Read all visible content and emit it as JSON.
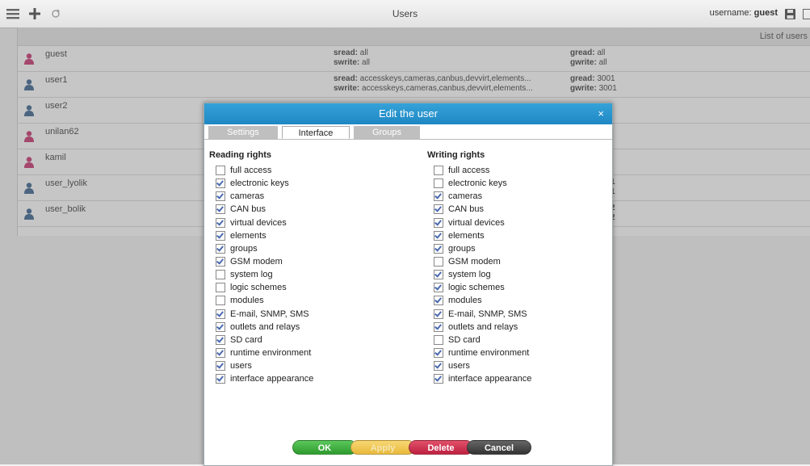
{
  "header": {
    "title": "Users",
    "username_label": "username:",
    "username_value": "guest"
  },
  "list": {
    "header_label": "List of users",
    "users": [
      {
        "name": "guest",
        "avatar_color": "#c2185b",
        "sread_label": "sread:",
        "sread": "all",
        "swrite_label": "swrite:",
        "swrite": "all",
        "gread_label": "gread:",
        "gread": "all",
        "gwrite_label": "gwrite:",
        "gwrite": "all"
      },
      {
        "name": "user1",
        "avatar_color": "#1f4f80",
        "sread_label": "sread:",
        "sread": "accesskeys,cameras,canbus,devvirt,elements...",
        "swrite_label": "swrite:",
        "swrite": "accesskeys,cameras,canbus,devvirt,elements...",
        "gread_label": "gread:",
        "gread": "3001",
        "gwrite_label": "gwrite:",
        "gwrite": "3001"
      },
      {
        "name": "user2",
        "avatar_color": "#1f4f80"
      },
      {
        "name": "unilan62",
        "avatar_color": "#c2185b"
      },
      {
        "name": "kamil",
        "avatar_color": "#c2185b"
      },
      {
        "name": "user_lyolik",
        "avatar_color": "#1f4f80",
        "gread": "1",
        "gwrite": "1"
      },
      {
        "name": "user_bolik",
        "avatar_color": "#1f4f80",
        "gread": "2",
        "gwrite": "2"
      }
    ]
  },
  "dialog": {
    "title": "Edit the user",
    "close_glyph": "×",
    "tabs": [
      "Settings",
      "Interface",
      "Groups"
    ],
    "active_tab": "Interface",
    "reading": {
      "title": "Reading rights",
      "items": [
        {
          "label": "full access",
          "checked": false
        },
        {
          "label": "electronic keys",
          "checked": true
        },
        {
          "label": "cameras",
          "checked": true
        },
        {
          "label": "CAN bus",
          "checked": true
        },
        {
          "label": "virtual devices",
          "checked": true
        },
        {
          "label": "elements",
          "checked": true
        },
        {
          "label": "groups",
          "checked": true
        },
        {
          "label": "GSM modem",
          "checked": true
        },
        {
          "label": "system log",
          "checked": false
        },
        {
          "label": "logic schemes",
          "checked": false
        },
        {
          "label": "modules",
          "checked": false
        },
        {
          "label": "E-mail, SNMP, SMS",
          "checked": true
        },
        {
          "label": "outlets and relays",
          "checked": true
        },
        {
          "label": "SD card",
          "checked": true
        },
        {
          "label": "runtime environment",
          "checked": true
        },
        {
          "label": "users",
          "checked": true
        },
        {
          "label": "interface appearance",
          "checked": true
        }
      ]
    },
    "writing": {
      "title": "Writing rights",
      "items": [
        {
          "label": "full access",
          "checked": false
        },
        {
          "label": "electronic keys",
          "checked": false
        },
        {
          "label": "cameras",
          "checked": true
        },
        {
          "label": "CAN bus",
          "checked": true
        },
        {
          "label": "virtual devices",
          "checked": true
        },
        {
          "label": "elements",
          "checked": true
        },
        {
          "label": "groups",
          "checked": true
        },
        {
          "label": "GSM modem",
          "checked": false
        },
        {
          "label": "system log",
          "checked": true
        },
        {
          "label": "logic schemes",
          "checked": true
        },
        {
          "label": "modules",
          "checked": true
        },
        {
          "label": "E-mail, SNMP, SMS",
          "checked": true
        },
        {
          "label": "outlets and relays",
          "checked": true
        },
        {
          "label": "SD card",
          "checked": false
        },
        {
          "label": "runtime environment",
          "checked": true
        },
        {
          "label": "users",
          "checked": true
        },
        {
          "label": "interface appearance",
          "checked": true
        }
      ]
    },
    "buttons": {
      "ok": "OK",
      "apply": "Apply",
      "delete": "Delete",
      "cancel": "Cancel"
    }
  },
  "colors": {
    "dialog_header": "#2a94cf",
    "ok": "#3aad3a",
    "apply": "#efc54f",
    "delete": "#d33455",
    "cancel": "#444444"
  }
}
